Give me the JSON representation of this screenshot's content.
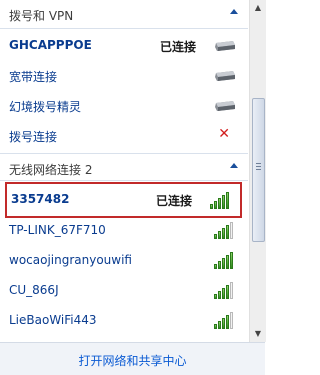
{
  "sections": {
    "dialup": {
      "title": "拨号和 VPN"
    },
    "wireless": {
      "title": "无线网络连接 2"
    }
  },
  "dialup_items": [
    {
      "label": "GHCAPPPOE",
      "status": "已连接"
    },
    {
      "label": "宽带连接"
    },
    {
      "label": "幻境拨号精灵"
    },
    {
      "label": "拨号连接"
    }
  ],
  "wifi_items": [
    {
      "label": "3357482",
      "status": "已连接",
      "signal": 5
    },
    {
      "label": "TP-LINK_67F710",
      "signal": 4
    },
    {
      "label": "wocaojingranyouwifi",
      "signal": 5
    },
    {
      "label": "CU_866J",
      "signal": 4
    },
    {
      "label": "LieBaoWiFi443",
      "signal": 4
    }
  ],
  "footer": {
    "link": "打开网络和共享中心"
  },
  "colors": {
    "accent": "#0b5bd3",
    "selected_border": "#c22a2a",
    "signal": "#2e8c1e"
  }
}
